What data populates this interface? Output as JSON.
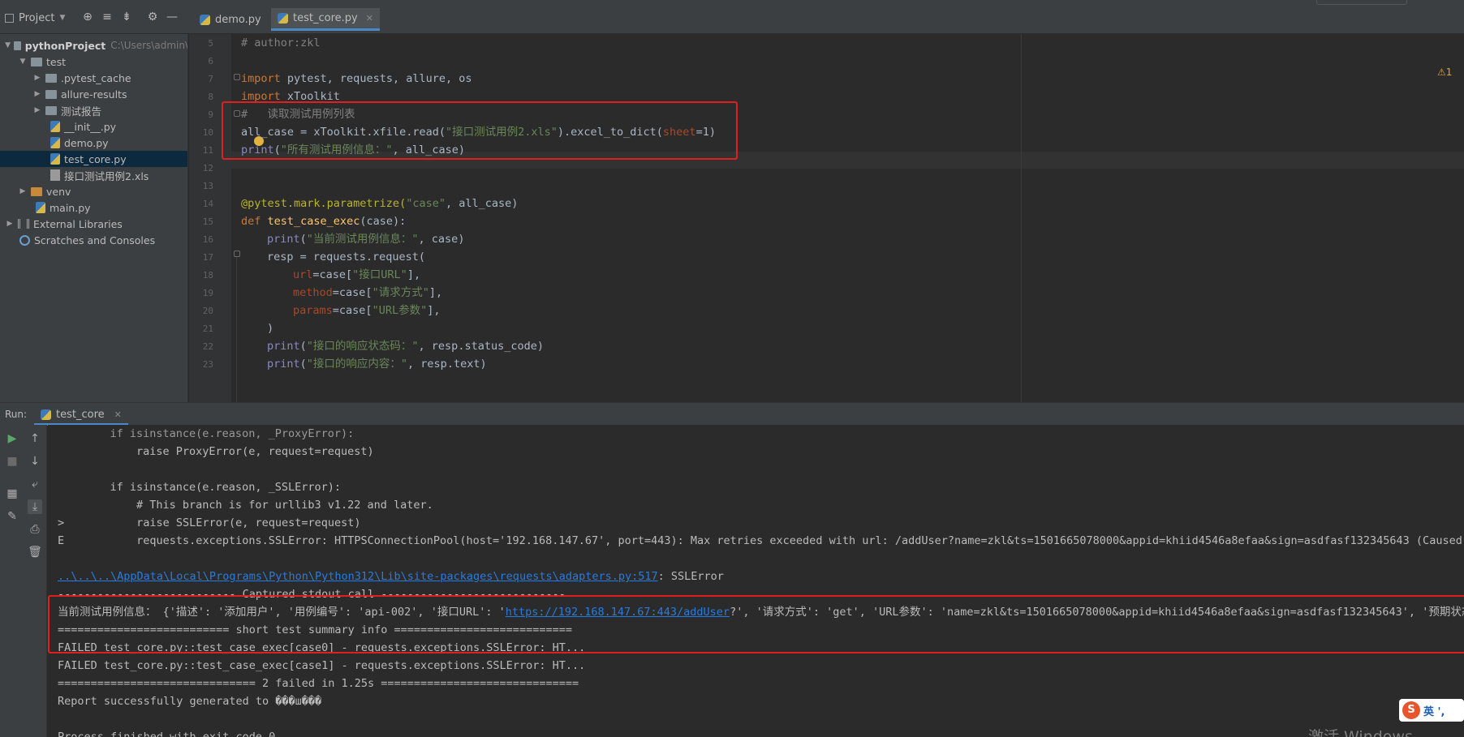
{
  "toolbar": {
    "project_label": "Project",
    "tabs": [
      {
        "label": "demo.py",
        "active": false
      },
      {
        "label": "test_core.py",
        "active": true
      }
    ]
  },
  "tree": {
    "root_name": "pythonProject",
    "root_path": "C:\\Users\\admin\\",
    "items": [
      {
        "label": "test"
      },
      {
        "label": ".pytest_cache"
      },
      {
        "label": "allure-results"
      },
      {
        "label": "测试报告"
      },
      {
        "label": "__init__.py"
      },
      {
        "label": "demo.py"
      },
      {
        "label": "test_core.py"
      },
      {
        "label": "接口测试用例2.xls"
      },
      {
        "label": "venv"
      },
      {
        "label": "main.py"
      },
      {
        "label": "External Libraries"
      },
      {
        "label": "Scratches and Consoles"
      }
    ]
  },
  "editor": {
    "warning_badge": "⚠1",
    "line_numbers": [
      "5",
      "6",
      "7",
      "8",
      "9",
      "10",
      "11",
      "12",
      "13",
      "14",
      "15",
      "16",
      "17",
      "18",
      "19",
      "20",
      "21",
      "22",
      "23"
    ],
    "code": {
      "author": "# author:zkl",
      "import1_kw": "import",
      "import1_rest": " pytest, requests, allure, os",
      "import2_kw": "import",
      "import2_rest": " xToolkit",
      "comment_read": "#   读取测试用例列表",
      "allcase_pre": "all_case = xToolkit.xfile.read(",
      "allcase_str": "\"接口测试用例2.xls\"",
      "allcase_mid": ").excel_to_dict(",
      "allcase_param": "sheet",
      "allcase_end": "=1)",
      "print1_fn": "print",
      "print1_str": "\"所有测试用例信息：\"",
      "print1_end": ", all_case)",
      "dec_pre": "@pytest.mark.parametrize(",
      "dec_str": "\"case\"",
      "dec_end": ", all_case)",
      "def_kw": "def",
      "def_name": "test_case_exec",
      "def_end": "(case):",
      "print2_fn": "print",
      "print2_str": "\"当前测试用例信息：\"",
      "print2_end": ", case)",
      "resp_line": "resp = requests.request(",
      "url_param": "url",
      "url_mid": "=case[",
      "url_str": "\"接口URL\"",
      "url_end": "],",
      "method_param": "method",
      "method_mid": "=case[",
      "method_str": "\"请求方式\"",
      "method_end": "],",
      "params_param": "params",
      "params_mid": "=case[",
      "params_str": "\"URL参数\"",
      "params_end": "],",
      "close_paren": ")",
      "print3_fn": "print",
      "print3_str": "\"接口的响应状态码：\"",
      "print3_end": ", resp.status_code)",
      "print4_fn": "print",
      "print4_str": "\"接口的响应内容：\"",
      "print4_end": ", resp.text)"
    }
  },
  "run": {
    "label": "Run:",
    "tab_label": "test_core",
    "console": {
      "l1": "    if isinstance(e.reason, _ProxyError):",
      "l2": "        raise ProxyError(e, request=request)",
      "l3": "    if isinstance(e.reason, _SSLError):",
      "l4": "        # This branch is for urllib3 v1.22 and later.",
      "l5_mark": ">",
      "l5": "        raise SSLError(e, request=request)",
      "l6_mark": "E",
      "l6": "        requests.exceptions.SSLError: HTTPSConnectionPool(host='192.168.147.67', port=443): Max retries exceeded with url: /addUser?name=zkl&ts=1501665078000&appid=khiid4546a8efaa&sign=asdfasf132345643 (Caused",
      "l7_link": "..\\..\\..\\AppData\\Local\\Programs\\Python\\Python312\\Lib\\site-packages\\requests\\adapters.py:517",
      "l7_rest": ": SSLError",
      "l8": "--------------------------- Captured stdout call ----------------------------",
      "l9_pre": "当前测试用例信息： {'描述': '添加用户', '用例编号': 'api-002', '接口URL': '",
      "l9_link": "https://192.168.147.67:443/addUser",
      "l9_post": "?', '请求方式': 'get', 'URL参数': 'name=zkl&ts=1501665078000&appid=khiid4546a8efaa&sign=asdfasf132345643', '预期状态码':",
      "l10": "========================== short test summary info ===========================",
      "l11": "FAILED test_core.py::test_case_exec[case0] - requests.exceptions.SSLError: HT...",
      "l12": "FAILED test_core.py::test_case_exec[case1] - requests.exceptions.SSLError: HT...",
      "l13": "============================== 2 failed in 1.25s ==============================",
      "l14": "Report successfully generated to ���ш���",
      "l15": "Process finished with exit code 0"
    }
  },
  "ime": {
    "logo": "S",
    "label": "英 ',"
  },
  "watermark": "激活 Windows",
  "colors": {
    "accent": "#4a88c7",
    "highlight_box": "#e02020",
    "keyword": "#cc7832",
    "string": "#6a8759",
    "link": "#287bde"
  }
}
